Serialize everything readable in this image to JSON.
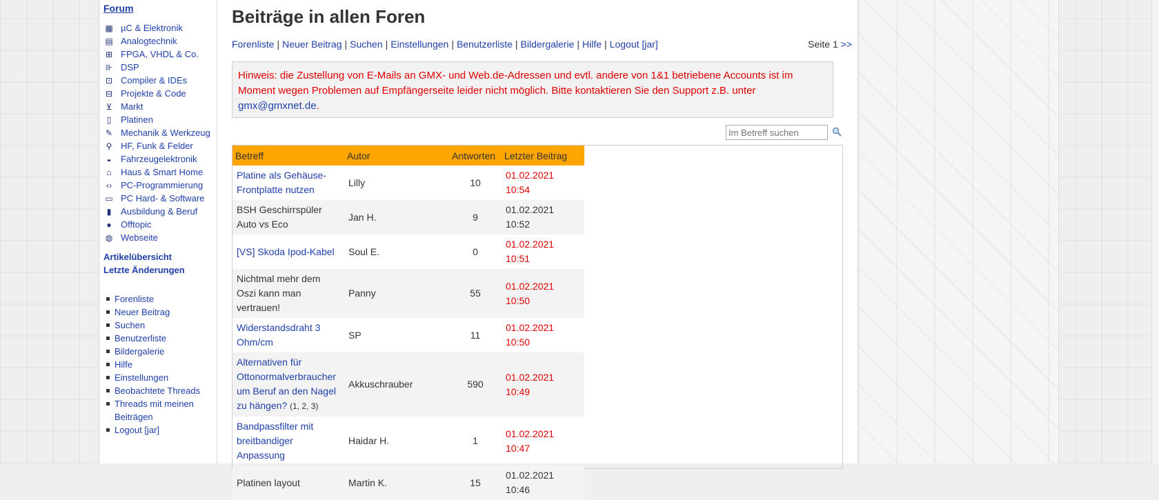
{
  "sidebar": {
    "forum_heading": "Forum",
    "forums": [
      {
        "icon": "chip-icon",
        "label": "µC & Elektronik"
      },
      {
        "icon": "analog-icon",
        "label": "Analogtechnik"
      },
      {
        "icon": "fpga-icon",
        "label": "FPGA, VHDL & Co."
      },
      {
        "icon": "dsp-icon",
        "label": "DSP"
      },
      {
        "icon": "compiler-icon",
        "label": "Compiler & IDEs"
      },
      {
        "icon": "project-icon",
        "label": "Projekte & Code"
      },
      {
        "icon": "cart-icon",
        "label": "Markt"
      },
      {
        "icon": "board-icon",
        "label": "Platinen"
      },
      {
        "icon": "wrench-icon",
        "label": "Mechanik & Werkzeug"
      },
      {
        "icon": "antenna-icon",
        "label": "HF, Funk & Felder"
      },
      {
        "icon": "car-icon",
        "label": "Fahrzeugelektronik"
      },
      {
        "icon": "house-icon",
        "label": "Haus & Smart Home"
      },
      {
        "icon": "code-icon",
        "label": "PC-Programmierung"
      },
      {
        "icon": "laptop-icon",
        "label": "PC Hard- & Software"
      },
      {
        "icon": "book-icon",
        "label": "Ausbildung & Beruf"
      },
      {
        "icon": "chat-icon",
        "label": "Offtopic"
      },
      {
        "icon": "globe-icon",
        "label": "Webseite"
      }
    ],
    "article_overview": "Artikelübersicht",
    "recent_changes": "Letzte Änderungen",
    "nav": [
      "Forenliste",
      "Neuer Beitrag",
      "Suchen",
      "Benutzerliste",
      "Bildergalerie",
      "Hilfe",
      "Einstellungen",
      "Beobachtete Threads",
      "Threads mit meinen Beiträgen",
      "Logout [jar]"
    ]
  },
  "main": {
    "title": "Beiträge in allen Foren",
    "topnav": [
      "Forenliste",
      "Neuer Beitrag",
      "Suchen",
      "Einstellungen",
      "Benutzerliste",
      "Bildergalerie",
      "Hilfe",
      "Logout [jar]"
    ],
    "page_label": "Seite 1",
    "next_label": ">>",
    "notice_text": "Hinweis: die Zustellung von E-Mails an GMX- und Web.de-Adressen und evtl. andere von 1&1 betriebene Accounts ist im Moment wegen Problemen auf Empfängerseite leider nicht möglich. Bitte kontaktieren Sie den Support z.B. unter",
    "notice_email": "gmx@gmxnet.de",
    "notice_end": ".",
    "search_placeholder": "Im Betreff suchen",
    "columns": [
      "Betreff",
      "Autor",
      "Antworten",
      "Letzter Beitrag"
    ],
    "rows": [
      {
        "subject": "Platine als Gehäuse-Frontplatte nutzen",
        "author": "Lilly",
        "replies": "10",
        "last": "01.02.2021 10:54",
        "new": true
      },
      {
        "subject": "BSH Geschirrspüler Auto vs Eco",
        "author": "Jan H.",
        "replies": "9",
        "last": "01.02.2021 10:52",
        "new": false
      },
      {
        "subject": "[VS] Skoda Ipod-Kabel",
        "author": "Soul E.",
        "replies": "0",
        "last": "01.02.2021 10:51",
        "new": true
      },
      {
        "subject": "Nichtmal mehr dem Oszi kann man vertrauen!",
        "author": "Panny",
        "replies": "55",
        "last": "01.02.2021 10:50",
        "new": false
      },
      {
        "subject": "Widerstandsdraht 3 Ohm/cm",
        "author": "SP",
        "replies": "11",
        "last": "01.02.2021 10:50",
        "new": true
      },
      {
        "subject": "Alternativen für Ottonormalverbraucher um Beruf an den Nagel zu hängen?",
        "pages": "(1, 2, 3)",
        "author": "Akkuschrauber",
        "replies": "590",
        "last": "01.02.2021 10:49",
        "new": true
      },
      {
        "subject": "Bandpassfilter mit breitbandiger Anpassung",
        "author": "Haidar H.",
        "replies": "1",
        "last": "01.02.2021 10:47",
        "new": true
      },
      {
        "subject": "Platinen layout",
        "author": "Martin K.",
        "replies": "15",
        "last": "01.02.2021 10:46",
        "new": false
      }
    ]
  }
}
